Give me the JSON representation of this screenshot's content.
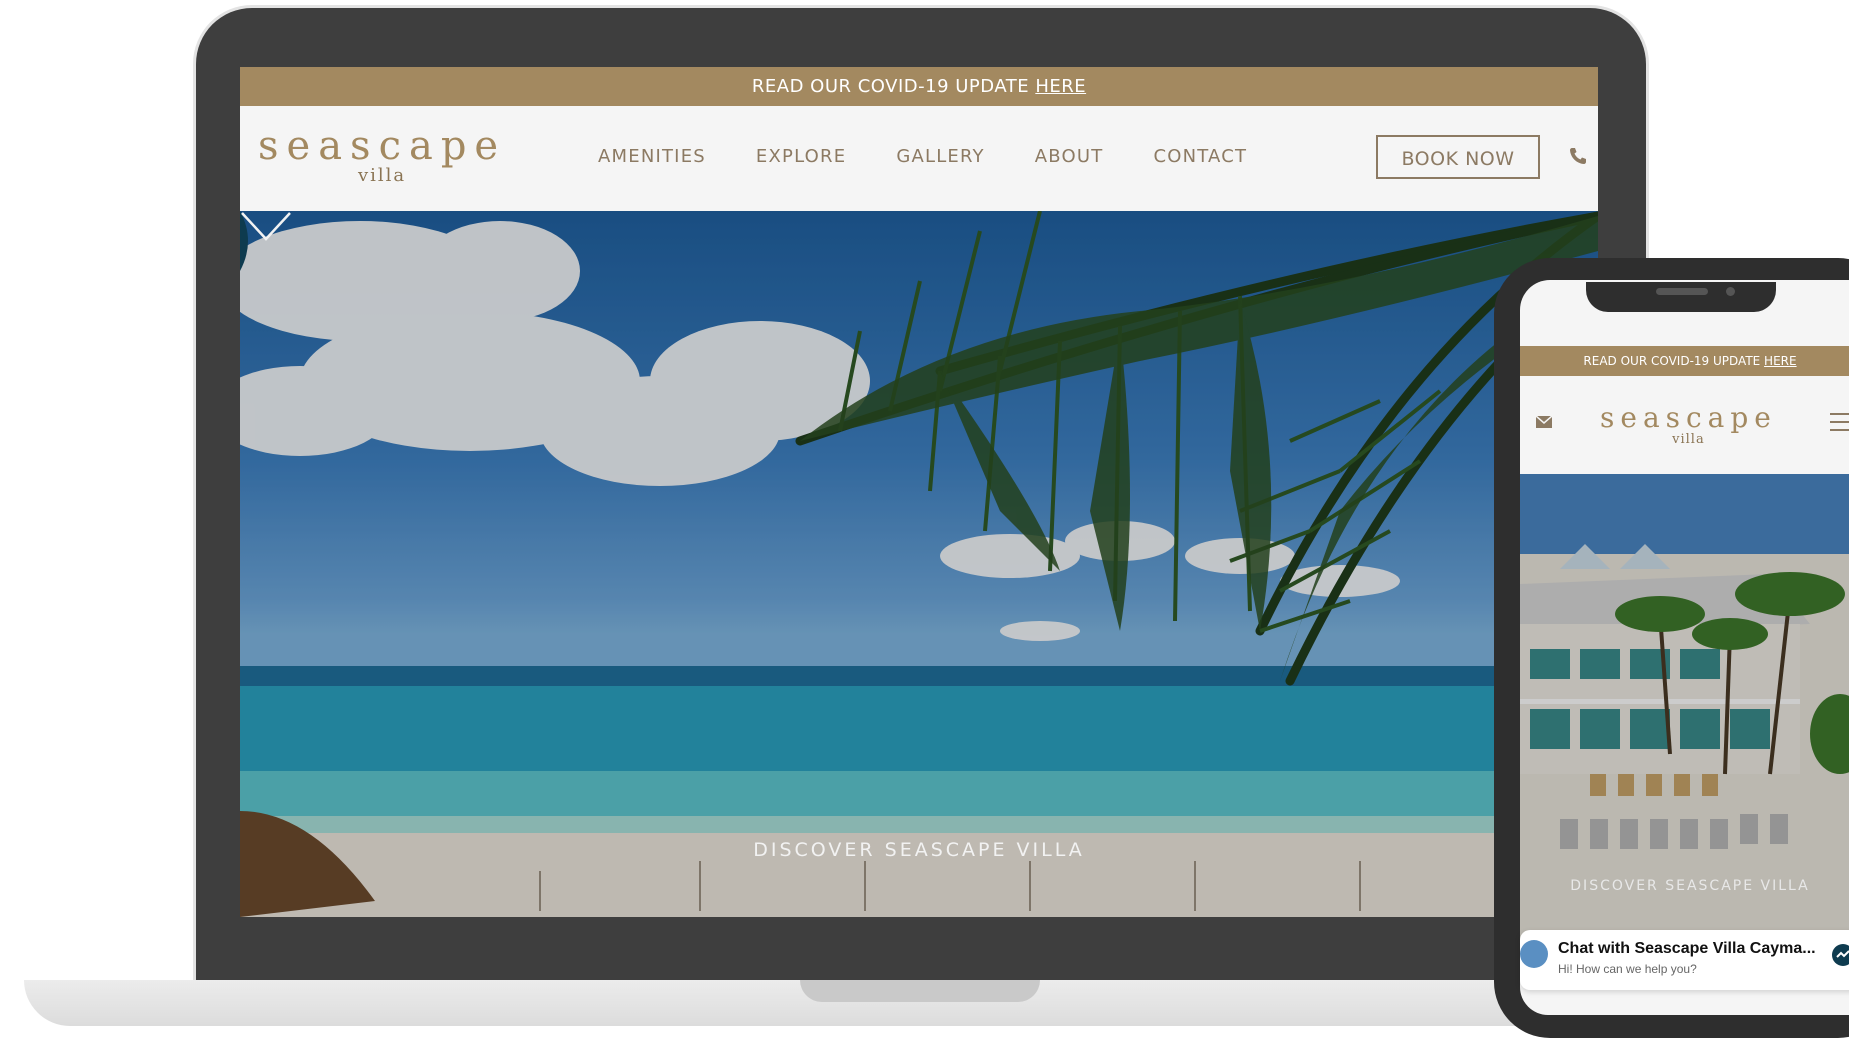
{
  "desktop": {
    "covid_banner": {
      "text": "READ OUR COVID-19 UPDATE ",
      "link": "HERE"
    },
    "logo": {
      "word": "seascape",
      "sub": "villa"
    },
    "nav": [
      "AMENITIES",
      "EXPLORE",
      "GALLERY",
      "ABOUT",
      "CONTACT"
    ],
    "book_button": "BOOK NOW",
    "phone_icon": "phone-icon",
    "hero": {
      "caption": "DISCOVER SEASCAPE VILLA",
      "scroll_icon": "chevron-down-icon"
    }
  },
  "mobile": {
    "covid_banner": {
      "text": "READ OUR COVID-19 UPDATE ",
      "link": "HERE"
    },
    "logo": {
      "word": "seascape",
      "sub": "villa"
    },
    "mail_icon": "envelope-icon",
    "menu_icon": "hamburger-icon",
    "hero": {
      "caption": "DISCOVER SEASCAPE VILLA"
    },
    "chat": {
      "title": "Chat with Seascape Villa Cayma...",
      "subtitle": "Hi! How can we help you?",
      "icon": "messenger-icon"
    }
  },
  "colors": {
    "brand_gold": "#a38960",
    "nav_text": "#8c7a63",
    "device_frame": "#3e3e3e"
  }
}
